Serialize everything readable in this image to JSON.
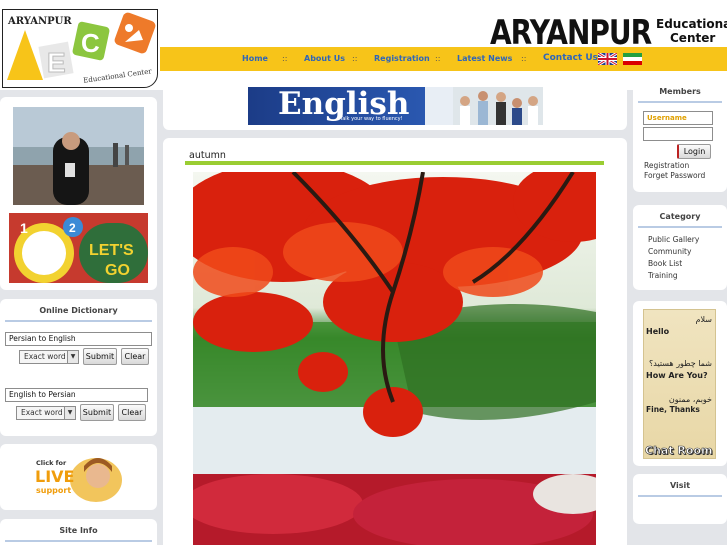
{
  "logo": {
    "brand": "ARYANPUR",
    "tagline": "Educational Center",
    "letters": [
      "A",
      "E",
      "C"
    ]
  },
  "site_title": {
    "main": "ARYANPUR",
    "line1": "Educational",
    "line2": "Center"
  },
  "nav": {
    "items": [
      "Home",
      "About Us",
      "Registration",
      "Latest News",
      "Contact Us"
    ],
    "separator": "::"
  },
  "banner": {
    "title": "English",
    "slogan": "Talk your way to fluency!"
  },
  "left_images": {
    "toys_text1": "LET'S",
    "toys_text2": "GO"
  },
  "dictionary": {
    "title": "Online Dictionary",
    "box1": {
      "value": "Persian to English",
      "mode": "Exact word",
      "submit": "Submit",
      "clear": "Clear"
    },
    "box2": {
      "value": "English to Persian",
      "mode": "Exact word",
      "submit": "Submit",
      "clear": "Clear"
    }
  },
  "live_support": {
    "click_for": "Click for",
    "live": "LIVE",
    "support": "support"
  },
  "site_info": {
    "title": "Site Info"
  },
  "article": {
    "title": "autumn"
  },
  "members": {
    "title": "Members",
    "username_placeholder": "Username",
    "login": "Login",
    "registration": "Registration",
    "forget_password": "Forget Password"
  },
  "category": {
    "title": "Category",
    "items": [
      "Public Gallery",
      "Community",
      "Book List",
      "Training"
    ]
  },
  "chatroom": {
    "rows": [
      {
        "fa": "سلام",
        "en": "Hello"
      },
      {
        "fa": "شما چطور هستید؟",
        "en": "How Are You?"
      },
      {
        "fa": "خوبم، ممنون",
        "en": "Fine, Thanks"
      }
    ],
    "label": "Chat Room"
  },
  "visit": {
    "title": "Visit"
  },
  "colors": {
    "nav_bg": "#f7c419",
    "nav_link": "#2f66b9",
    "accent_line": "#9acd32",
    "page_bg": "#e3e5e9",
    "username_label": "#e0a000"
  }
}
